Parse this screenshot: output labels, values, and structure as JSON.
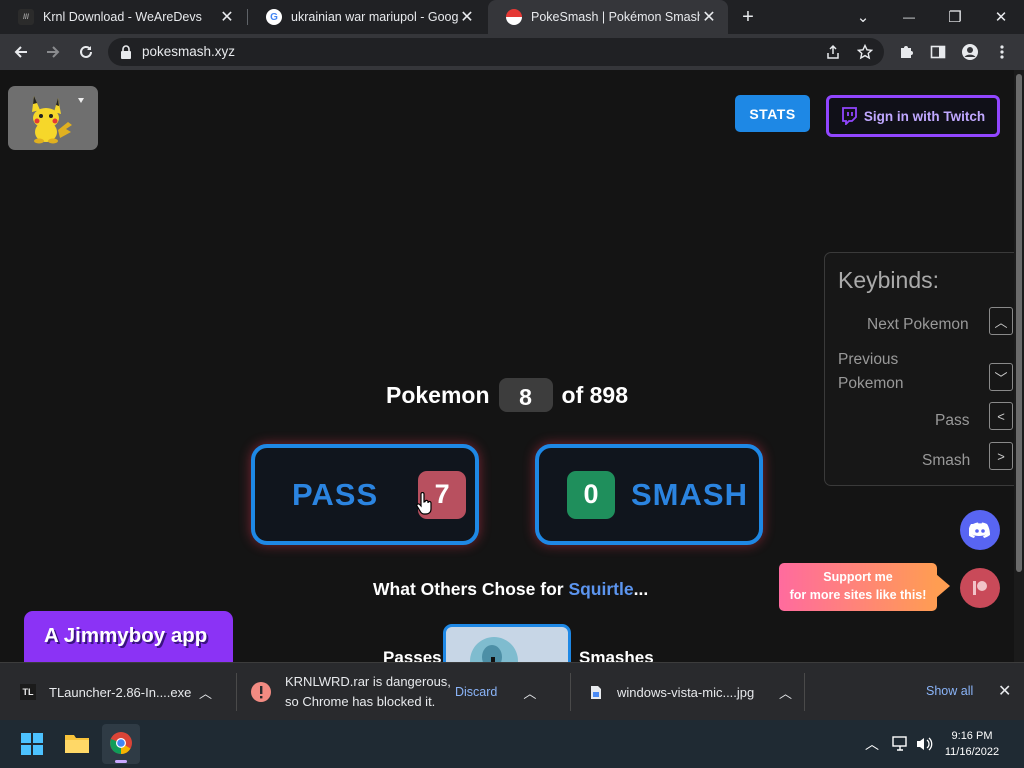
{
  "tabs": [
    {
      "title": "Krnl Download - WeAreDevs",
      "close": "✕"
    },
    {
      "title": "ukrainian war mariupol - Google",
      "close": "✕"
    },
    {
      "title": "PokeSmash | Pokémon Smash or",
      "close": "✕"
    }
  ],
  "new_tab": "+",
  "window_controls": {
    "minimize": "—",
    "restore": "❐",
    "close": "✕",
    "tablist": "⌄"
  },
  "toolbar": {
    "url": "pokesmash.xyz"
  },
  "page": {
    "stats_label": "STATS",
    "twitch_label": "Sign in with Twitch",
    "keybinds": {
      "title": "Keybinds:",
      "items": [
        {
          "label": "Next Pokemon",
          "key": "︿"
        },
        {
          "label": "Previous Pokemon",
          "key": "﹀"
        },
        {
          "label": "Pass",
          "key": "<"
        },
        {
          "label": "Smash",
          "key": ">"
        }
      ]
    },
    "counter": {
      "prefix": "Pokemon",
      "current": "8",
      "suffix": "of 898"
    },
    "pass": {
      "label": "PASS",
      "count": "7"
    },
    "smash": {
      "label": "SMASH",
      "count": "0"
    },
    "others": {
      "prefix": "What Others Chose for ",
      "pokemon": "Squirtle",
      "suffix": "..."
    },
    "passes_label": "Passes",
    "smashes_label": "Smashes",
    "jimmy_label": "A Jimmyboy app",
    "support_line1": "Support me",
    "support_line2": "for more sites like this!"
  },
  "downloads": [
    {
      "name": "TLauncher-2.86-In....exe",
      "icon": "TL"
    },
    {
      "warning_line1": "KRNLWRD.rar is dangerous,",
      "warning_line2": "so Chrome has blocked it.",
      "action": "Discard"
    },
    {
      "name": "windows-vista-mic....jpg"
    }
  ],
  "downloads_show_all": "Show all",
  "clock": {
    "time": "9:16 PM",
    "date": "11/16/2022"
  },
  "colors": {
    "accent": "#1e88e5",
    "twitch": "#9146ff",
    "pass_badge": "#b8505f",
    "smash_badge": "#1f8f5c",
    "jimmy": "#8b33f5"
  }
}
